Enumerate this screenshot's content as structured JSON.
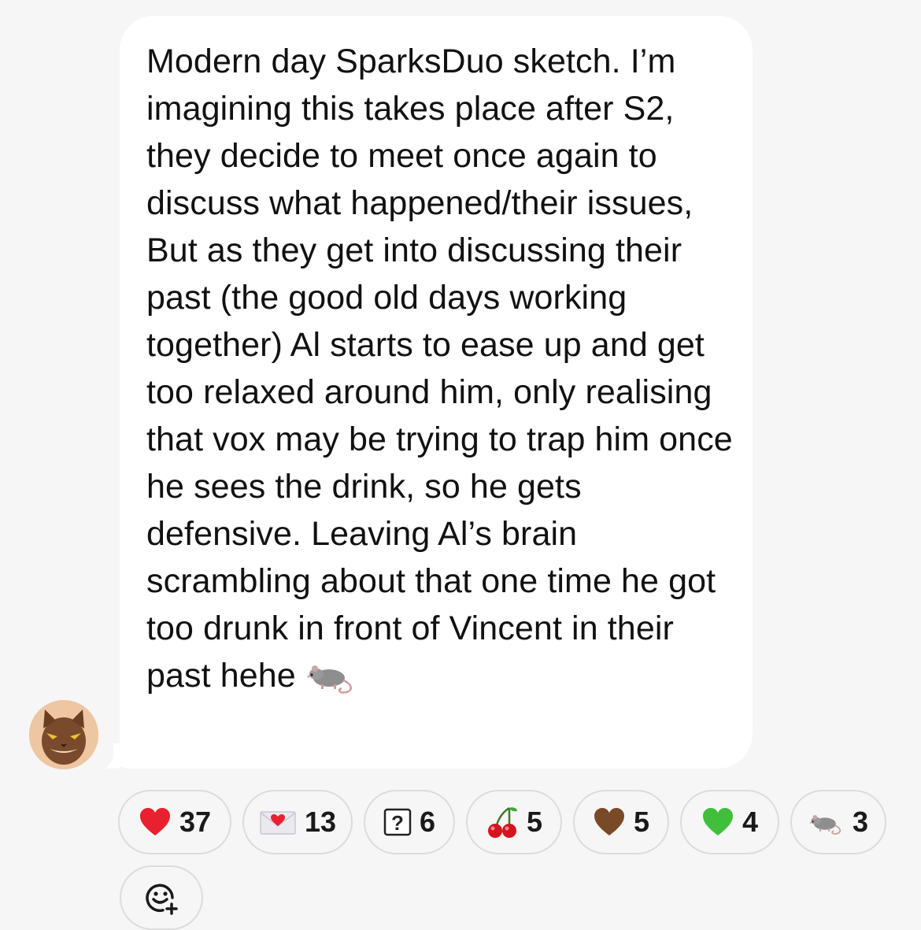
{
  "message": {
    "text": "Modern day SparksDuo sketch. I’m imagining this takes place after S2, they decide to meet once again to discuss what happened/their issues, But as they get into discussing their past (the good old days working together) Al starts to ease up and get too relaxed around him, only realising that vox may be trying to trap him once he sees the drink, so he gets defensive. Leaving Al’s brain scrambling about that one time he got too drunk in front of Vincent in their past hehe",
    "trailing_emoji_icon": "rat-icon"
  },
  "sender": {
    "avatar_icon": "cat-avatar-icon"
  },
  "reactions": [
    {
      "icon": "red-heart-icon",
      "count": "37"
    },
    {
      "icon": "love-letter-icon",
      "count": "13"
    },
    {
      "icon": "question-box-icon",
      "count": "6"
    },
    {
      "icon": "cherries-icon",
      "count": "5"
    },
    {
      "icon": "brown-heart-icon",
      "count": "5"
    },
    {
      "icon": "green-heart-icon",
      "count": "4"
    },
    {
      "icon": "rat-icon",
      "count": "3"
    }
  ],
  "add_reaction": {
    "icon": "add-reaction-icon"
  },
  "colors": {
    "background": "#f6f6f6",
    "bubble": "#ffffff",
    "text": "#111111",
    "red_heart": "#e8202f",
    "brown_heart": "#7a4a28",
    "green_heart": "#3fbf3a"
  }
}
